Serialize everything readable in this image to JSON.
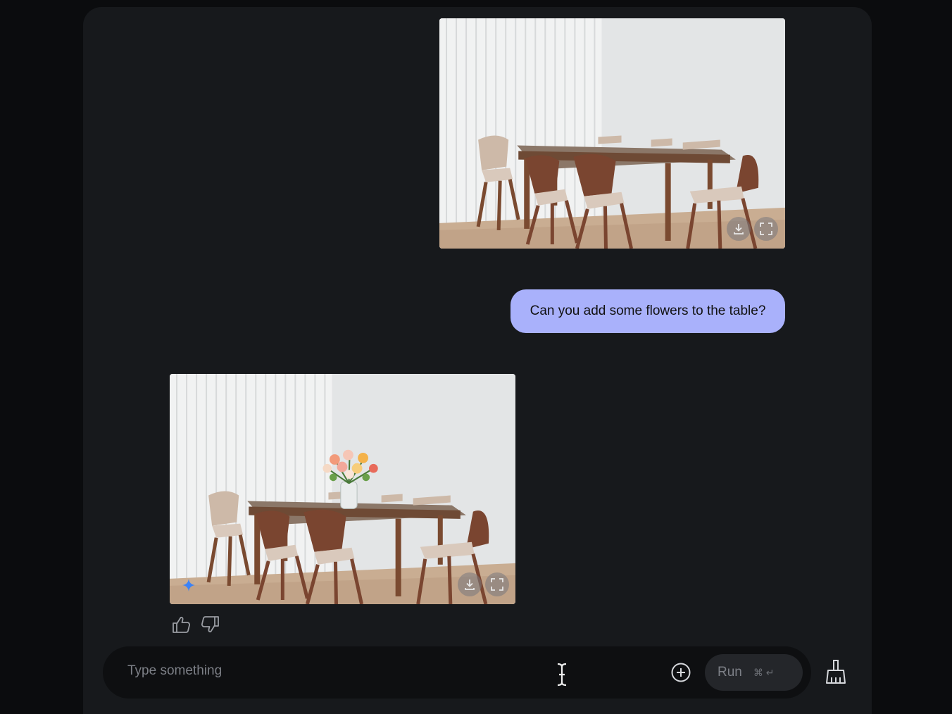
{
  "chat": {
    "messages": [
      {
        "role": "user",
        "type": "image",
        "description": "dining room with wooden table and chairs"
      },
      {
        "role": "user",
        "type": "text",
        "text": "Can you add some flowers to the table?"
      },
      {
        "role": "model",
        "type": "image",
        "description": "dining room with flowers on the table"
      }
    ]
  },
  "input": {
    "placeholder": "Type something",
    "run_label": "Run",
    "run_shortcut": "⌘ ↵"
  },
  "icons": {
    "download": "download-icon",
    "fullscreen": "fullscreen-icon",
    "sparkle": "sparkle-icon",
    "thumbs_up": "thumbs-up-icon",
    "thumbs_down": "thumbs-down-icon",
    "text_cursor": "text-cursor-icon",
    "add": "add-circle-icon",
    "clear": "broom-icon"
  },
  "colors": {
    "user_bubble": "#a9b1fb",
    "sparkle": "#3b82f6"
  }
}
